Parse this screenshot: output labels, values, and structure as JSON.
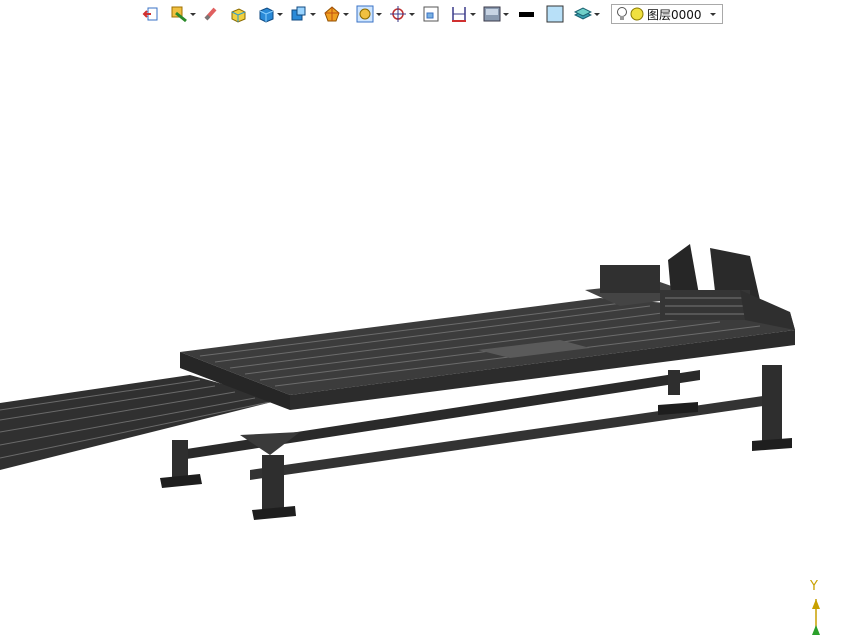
{
  "toolbar": {
    "items": [
      {
        "icon": "exit-sketch-icon",
        "dropdown": false
      },
      {
        "icon": "sketch-icon",
        "dropdown": true
      },
      {
        "icon": "eraser-icon",
        "dropdown": false
      },
      {
        "icon": "extrude-icon",
        "dropdown": false
      },
      {
        "icon": "box-view-icon",
        "dropdown": true
      },
      {
        "icon": "view-orientation-icon",
        "dropdown": true
      },
      {
        "icon": "section-view-icon",
        "dropdown": true
      },
      {
        "icon": "zoom-fit-icon",
        "dropdown": true
      },
      {
        "icon": "target-icon",
        "dropdown": true
      },
      {
        "icon": "zoom-window-icon",
        "dropdown": false
      },
      {
        "icon": "measure-icon",
        "dropdown": true
      },
      {
        "icon": "display-style-icon",
        "dropdown": true
      },
      {
        "icon": "line-color-icon",
        "dropdown": false
      },
      {
        "icon": "face-color-icon",
        "dropdown": false
      },
      {
        "icon": "layer-manager-icon",
        "dropdown": true
      }
    ],
    "layer_name": "图层0000"
  },
  "colors": {
    "model": "#3a3a3a",
    "model_dark": "#1e1e1e",
    "model_light": "#5a5a5a",
    "background": "#ffffff",
    "axis_y": "#c8a000",
    "axis_green": "#2aa02a"
  },
  "triad": {
    "axis_label": "Y"
  }
}
